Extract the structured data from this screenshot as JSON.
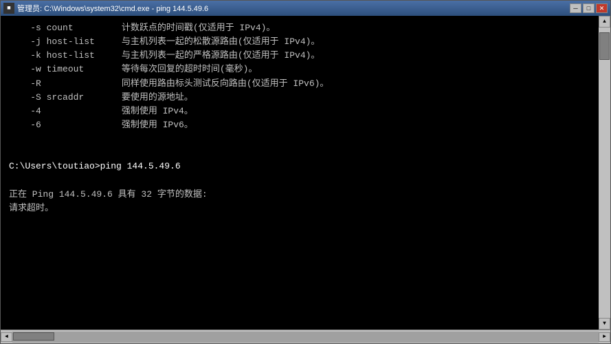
{
  "window": {
    "title": "管理员: C:\\Windows\\system32\\cmd.exe - ping  144.5.49.6",
    "icon": "■"
  },
  "titlebar": {
    "minimize_label": "─",
    "maximize_label": "□",
    "close_label": "✕"
  },
  "terminal": {
    "lines": [
      {
        "type": "cmd",
        "text": "    -s count         计数跃点的时间戳(仅适用于 IPv4)。"
      },
      {
        "type": "cmd",
        "text": "    -j host-list     与主机列表一起的松散源路由(仅适用于 IPv4)。"
      },
      {
        "type": "cmd",
        "text": "    -k host-list     与主机列表一起的严格源路由(仅适用于 IPv4)。"
      },
      {
        "type": "cmd",
        "text": "    -w timeout       等待每次回复的超时时间(毫秒)。"
      },
      {
        "type": "cmd",
        "text": "    -R               同样使用路由标头测试反向路由(仅适用于 IPv6)。"
      },
      {
        "type": "cmd",
        "text": "    -S srcaddr       要使用的源地址。"
      },
      {
        "type": "cmd",
        "text": "    -4               强制使用 IPv4。"
      },
      {
        "type": "cmd",
        "text": "    -6               强制使用 IPv6。"
      },
      {
        "type": "empty",
        "text": ""
      },
      {
        "type": "empty",
        "text": ""
      },
      {
        "type": "prompt",
        "text": "C:\\Users\\toutiao>ping 144.5.49.6"
      },
      {
        "type": "empty",
        "text": ""
      },
      {
        "type": "info",
        "text": "正在 Ping 144.5.49.6 具有 32 字节的数据:"
      },
      {
        "type": "timeout",
        "text": "请求超时。"
      }
    ]
  },
  "scrollbar": {
    "up_arrow": "▲",
    "down_arrow": "▼",
    "left_arrow": "◄",
    "right_arrow": "►"
  }
}
